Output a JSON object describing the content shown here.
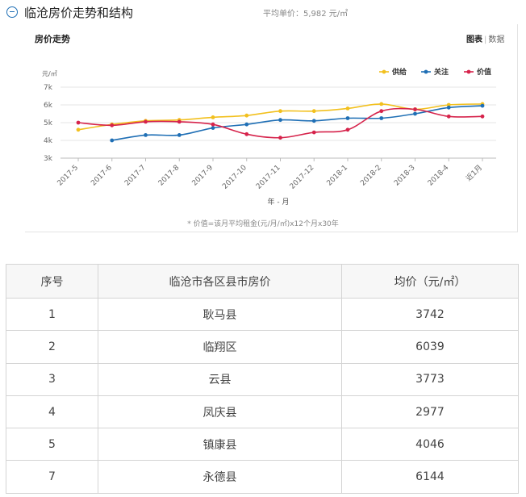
{
  "header": {
    "title": "临沧房价走势和结构",
    "avg_price": "平均单价：5,982 元/㎡"
  },
  "panel": {
    "title": "房价走势",
    "view_chart": "图表",
    "view_data": "数据"
  },
  "chart_data": {
    "type": "line",
    "categories": [
      "2017-5",
      "2017-6",
      "2017-7",
      "2017-8",
      "2017-9",
      "2017-10",
      "2017-11",
      "2017-12",
      "2018-1",
      "2018-2",
      "2018-3",
      "2018-4",
      "近1月"
    ],
    "series": [
      {
        "name": "供给",
        "color": "#f2c01e",
        "values": [
          4.6,
          4.9,
          5.1,
          5.15,
          5.3,
          5.4,
          5.65,
          5.65,
          5.8,
          6.05,
          5.75,
          6.0,
          6.05
        ]
      },
      {
        "name": "关注",
        "color": "#1f6fb5",
        "values": [
          null,
          4.0,
          4.3,
          4.3,
          4.7,
          4.9,
          5.15,
          5.1,
          5.25,
          5.25,
          5.5,
          5.85,
          5.95
        ]
      },
      {
        "name": "价值",
        "color": "#d6234b",
        "values": [
          5.0,
          4.85,
          5.05,
          5.05,
          4.9,
          4.35,
          4.15,
          4.45,
          4.6,
          5.65,
          5.75,
          5.35,
          5.35
        ]
      }
    ],
    "yticks": [
      "3k",
      "4k",
      "5k",
      "6k",
      "7k"
    ],
    "ylim": [
      3,
      7
    ],
    "yunit": "元/㎡",
    "xlabel": "年 - 月",
    "grid": true,
    "legend": "top-right"
  },
  "note": "* 价值=该月平均租金(元/月/㎡)x12个月x30年",
  "table": {
    "headers": [
      "序号",
      "临沧市各区县市房价",
      "均价（元/㎡）"
    ],
    "rows": [
      [
        "1",
        "耿马县",
        "3742"
      ],
      [
        "2",
        "临翔区",
        "6039"
      ],
      [
        "3",
        "云县",
        "3773"
      ],
      [
        "4",
        "凤庆县",
        "2977"
      ],
      [
        "5",
        "镇康县",
        "4046"
      ],
      [
        "7",
        "永德县",
        "6144"
      ]
    ]
  }
}
